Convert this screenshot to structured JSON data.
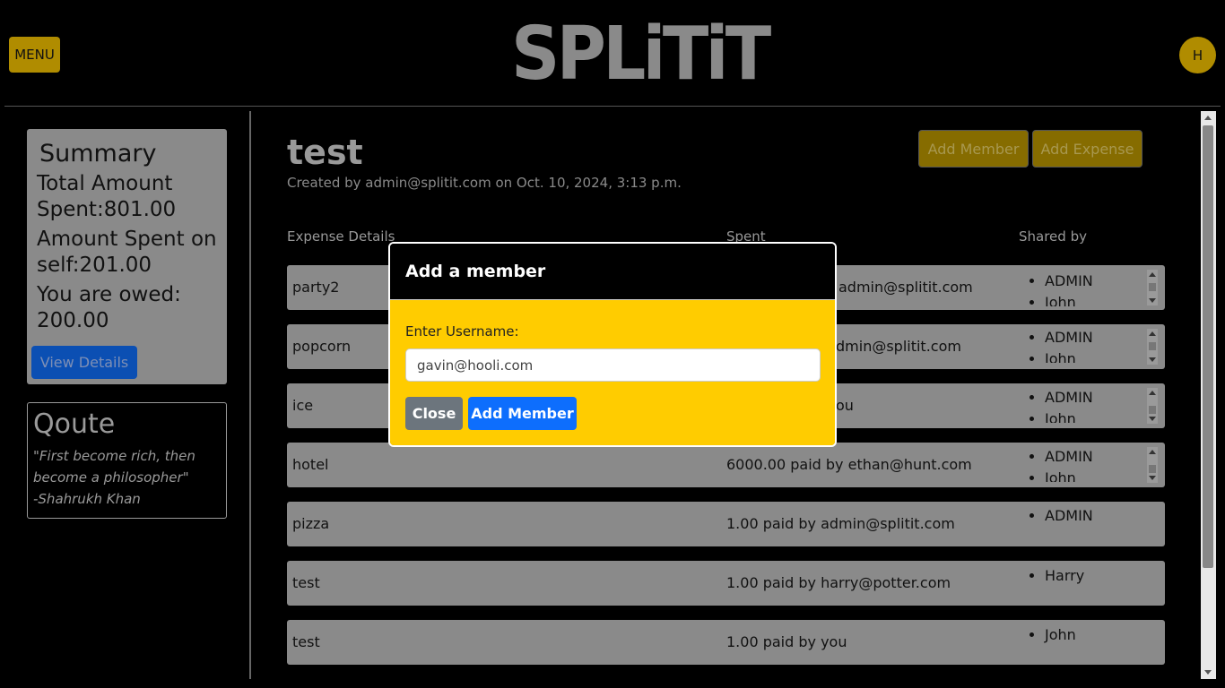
{
  "header": {
    "menu_label": "MENU",
    "logo_text": "SPLiTiT",
    "avatar_initial": "H"
  },
  "summary": {
    "title": "Summary",
    "total_spent": "Total Amount Spent:801.00",
    "spent_on_self": "Amount Spent on self:201.00",
    "owed": "You are owed: 200.00",
    "view_details_label": "View Details"
  },
  "quote": {
    "title": "Qoute",
    "text": "\"First become rich, then become a philosopher\"",
    "author": "-Shahrukh Khan"
  },
  "group": {
    "title": "test",
    "created": "Created by admin@splitit.com on Oct. 10, 2024, 3:13 p.m.",
    "add_member_label": "Add Member",
    "add_expense_label": "Add Expense"
  },
  "columns": {
    "details": "Expense Details",
    "spent": "Spent",
    "shared": "Shared by"
  },
  "expenses": [
    {
      "detail": "party2",
      "spent": "admin@splitit.com",
      "shared": [
        "ADMIN",
        "John"
      ]
    },
    {
      "detail": "popcorn",
      "spent": "dmin@splitit.com",
      "shared": [
        "ADMIN",
        "John"
      ]
    },
    {
      "detail": "ice",
      "spent": "ou",
      "shared": [
        "ADMIN",
        "John"
      ]
    },
    {
      "detail": "hotel",
      "spent": "6000.00 paid by ethan@hunt.com",
      "shared": [
        "ADMIN",
        "John"
      ]
    },
    {
      "detail": "pizza",
      "spent": "1.00 paid by admin@splitit.com",
      "shared": [
        "ADMIN"
      ]
    },
    {
      "detail": "test",
      "spent": "1.00 paid by harry@potter.com",
      "shared": [
        "Harry"
      ]
    },
    {
      "detail": "test",
      "spent": "1.00 paid by you",
      "shared": [
        "John"
      ]
    }
  ],
  "modal": {
    "title": "Add a member",
    "label": "Enter Username:",
    "input_value": "gavin@hooli.com",
    "close_label": "Close",
    "add_label": "Add Member"
  }
}
